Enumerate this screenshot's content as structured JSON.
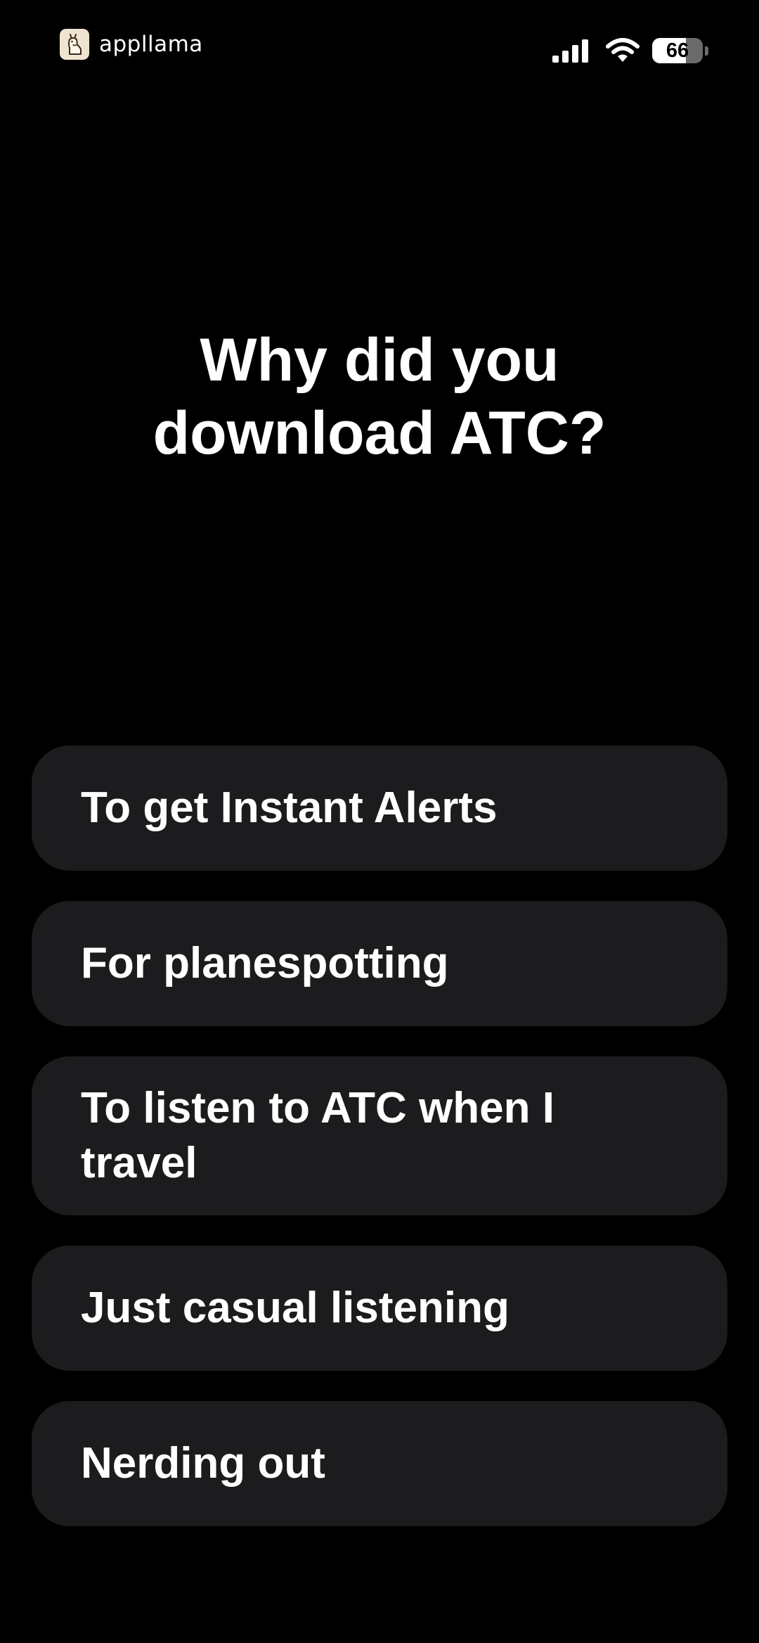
{
  "status_bar": {
    "brand": "appllama",
    "battery_level": "66",
    "battery_percent": 66,
    "icons": [
      "signal-icon",
      "wifi-icon",
      "battery-icon"
    ]
  },
  "question": {
    "line1": "Why did you",
    "line2": "download ATC?"
  },
  "options": [
    {
      "label": "To get Instant Alerts"
    },
    {
      "label": "For planespotting"
    },
    {
      "label": "To listen to ATC when I travel"
    },
    {
      "label": "Just casual listening"
    },
    {
      "label": "Nerding out"
    }
  ],
  "colors": {
    "background": "#000000",
    "card": "#1c1c1e",
    "text": "#ffffff"
  }
}
